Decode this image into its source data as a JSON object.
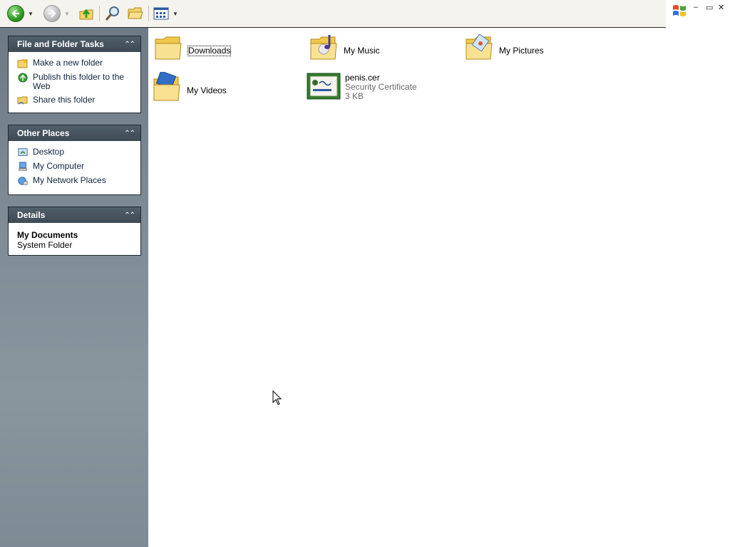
{
  "toolbar": {
    "back_icon": "back-arrow-icon",
    "forward_icon": "forward-arrow-icon",
    "up_icon": "up-folder-icon",
    "search_icon": "search-icon",
    "folders_icon": "folders-icon",
    "views_icon": "views-icon"
  },
  "window_controls": {
    "minimize": "–",
    "restore": "▭",
    "close": "✕"
  },
  "sidebar": {
    "file_tasks": {
      "title": "File and Folder Tasks",
      "items": [
        "Make a new folder",
        "Publish this folder to the Web",
        "Share this folder"
      ]
    },
    "other_places": {
      "title": "Other Places",
      "items": [
        "Desktop",
        "My Computer",
        "My Network Places"
      ]
    },
    "details": {
      "title": "Details",
      "name": "My Documents",
      "type": "System Folder"
    }
  },
  "content": {
    "items": [
      {
        "name": "Downloads",
        "icon": "folder-icon"
      },
      {
        "name": "My Music",
        "icon": "music-folder-icon"
      },
      {
        "name": "My Pictures",
        "icon": "pictures-folder-icon"
      },
      {
        "name": "My Videos",
        "icon": "videos-folder-icon"
      },
      {
        "name": "penis.cer",
        "type": "Security Certificate",
        "size": "3 KB",
        "icon": "certificate-icon"
      }
    ]
  },
  "colors": {
    "sidebar": "#7c8993",
    "panel_header": "#44515b",
    "link": "#10243d",
    "back_green": "#2f9a22"
  }
}
